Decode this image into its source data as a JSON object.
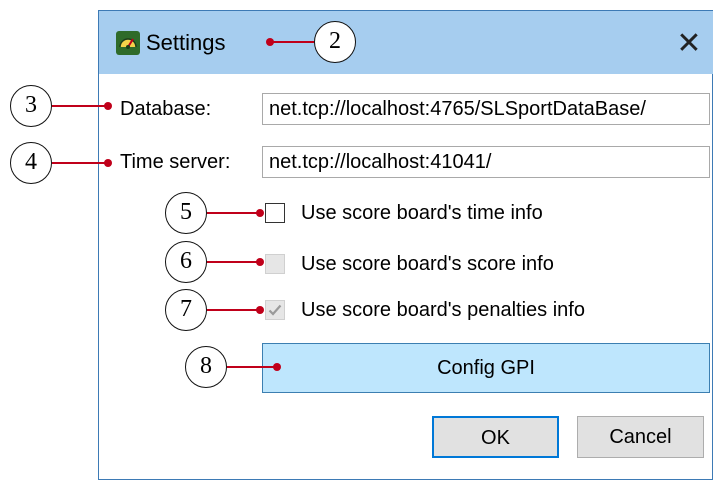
{
  "window": {
    "title": "Settings",
    "close_glyph": "✕",
    "titlebar_color": "#a6cdef"
  },
  "form": {
    "database": {
      "label": "Database:",
      "value": "net.tcp://localhost:4765/SLSportDataBase/"
    },
    "time_server": {
      "label": "Time server:",
      "value": "net.tcp://localhost:41041/"
    }
  },
  "checkboxes": [
    {
      "label": "Use score board's time info",
      "checked": false,
      "enabled": true
    },
    {
      "label": "Use score board's score info",
      "checked": false,
      "enabled": false
    },
    {
      "label": "Use score board's penalties info",
      "checked": true,
      "enabled": false
    }
  ],
  "buttons": {
    "config_gpi": "Config GPI",
    "ok": "OK",
    "cancel": "Cancel"
  },
  "callouts": {
    "c2": "2",
    "c3": "3",
    "c4": "4",
    "c5": "5",
    "c6": "6",
    "c7": "7",
    "c8": "8"
  },
  "icons": {
    "app": "app-gauge-icon",
    "close": "close-icon",
    "check": "checkmark-icon"
  },
  "colors": {
    "leader": "#c0001a",
    "accent": "#0078d7",
    "gpi_button": "#bee6fd"
  }
}
